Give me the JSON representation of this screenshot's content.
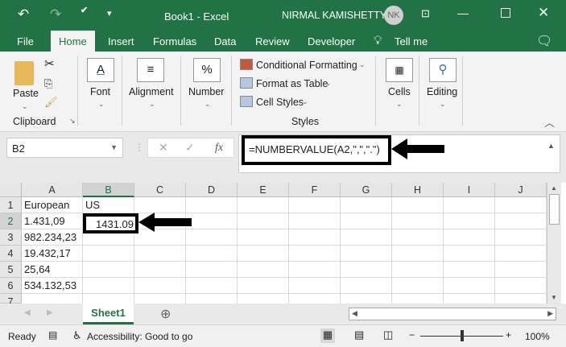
{
  "title_bar": {
    "title": "Book1  -  Excel",
    "user": "NIRMAL KAMISHETTY",
    "initials": "NK"
  },
  "tabs": [
    "File",
    "Home",
    "Insert",
    "Formulas",
    "Data",
    "Review",
    "Developer",
    "Tell me"
  ],
  "ribbon": {
    "paste": "Paste",
    "clipboard": "Clipboard",
    "font": "Font",
    "alignment": "Alignment",
    "number": "Number",
    "conditional_formatting": "Conditional Formatting",
    "format_as_table": "Format as Table",
    "cell_styles": "Cell Styles",
    "styles": "Styles",
    "cells": "Cells",
    "editing": "Editing"
  },
  "formula_bar": {
    "name_box": "B2",
    "fx": "fx",
    "formula": "=NUMBERVALUE(A2,\",\",\".\")"
  },
  "columns": [
    "A",
    "B",
    "C",
    "D",
    "E",
    "F",
    "G",
    "H",
    "I",
    "J"
  ],
  "rows": [
    "1",
    "2",
    "3",
    "4",
    "5",
    "6",
    "7"
  ],
  "cells": {
    "A1": "European",
    "B1": "US",
    "A2": "1.431,09",
    "B2": "1431.09",
    "A3": "982.234,23",
    "A4": "19.432,17",
    "A5": "25,64",
    "A6": "534.132,53"
  },
  "sheet_tab": "Sheet1",
  "status": {
    "ready": "Ready",
    "accessibility": "Accessibility: Good to go",
    "zoom": "100%"
  },
  "colors": {
    "excel_green": "#217346"
  }
}
